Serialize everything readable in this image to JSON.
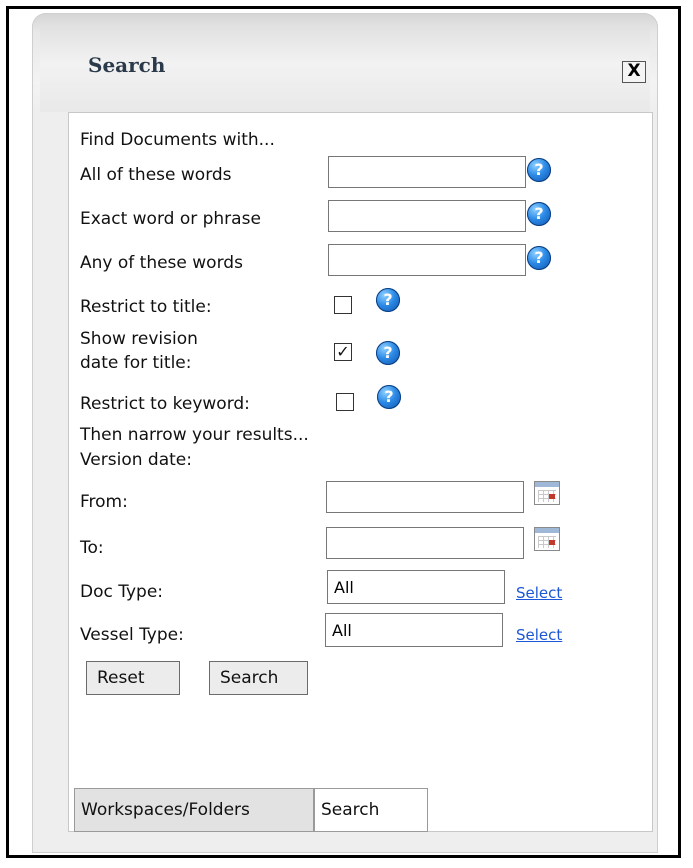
{
  "panel": {
    "title": "Search",
    "close_label": "X"
  },
  "form": {
    "section_find": "Find Documents with...",
    "all_words_label": "All of these words",
    "all_words_value": "",
    "exact_label": "Exact word or phrase",
    "exact_value": "",
    "any_words_label": "Any of these words",
    "any_words_value": "",
    "restrict_title_label": "Restrict to title:",
    "restrict_title_checked": false,
    "show_revision_label_1": "Show revision",
    "show_revision_label_2": "date for title:",
    "show_revision_checked": true,
    "restrict_keyword_label": "Restrict to keyword:",
    "restrict_keyword_checked": false,
    "section_narrow": "Then narrow your results...",
    "version_date_label": "Version date:",
    "from_label": "From:",
    "from_value": "",
    "to_label": "To:",
    "to_value": "",
    "doc_type_label": "Doc Type:",
    "doc_type_value": "All",
    "doc_type_select": "Select",
    "vessel_type_label": "Vessel Type:",
    "vessel_type_value": "All",
    "vessel_type_select": "Select",
    "help_glyph": "?",
    "check_glyph": "✓"
  },
  "buttons": {
    "reset": "Reset",
    "search": "Search"
  },
  "tabs": [
    {
      "label": "Workspaces/Folders",
      "active": true
    },
    {
      "label": "Search",
      "active": false
    }
  ],
  "colors": {
    "link": "#1b57d6",
    "title": "#2b3a4a",
    "help_icon": "#2b8ae6"
  },
  "icons": {
    "help": "question-help-icon",
    "calendar": "calendar-icon",
    "close": "close-icon"
  }
}
